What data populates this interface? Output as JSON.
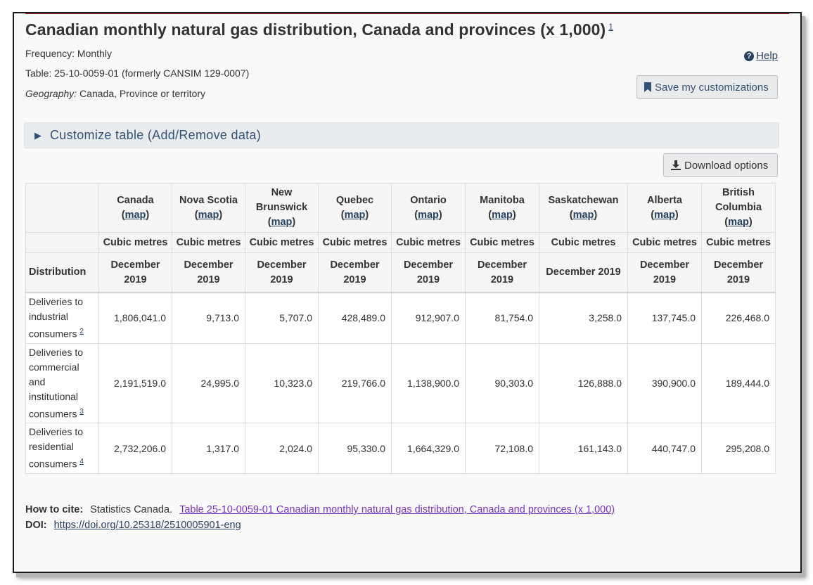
{
  "title": "Canadian monthly natural gas distribution, Canada and provinces (x 1,000)",
  "title_footnote": "1",
  "frequency": "Frequency: Monthly",
  "table_id": "Table: 25-10-0059-01 (formerly CANSIM 129-0007)",
  "geography_label": "Geography:",
  "geography_value": "Canada, Province or territory",
  "help_label": "Help",
  "save_label": "Save my customizations",
  "customize_label": "Customize table (Add/Remove data)",
  "download_label": "Download options",
  "table": {
    "map_link": "map",
    "row_header_label": "Distribution",
    "columns": [
      {
        "name": "Canada",
        "unit": "Cubic metres",
        "period": "December 2019"
      },
      {
        "name": "Nova Scotia",
        "unit": "Cubic metres",
        "period": "December 2019"
      },
      {
        "name": "New Brunswick",
        "unit": "Cubic metres",
        "period": "December 2019"
      },
      {
        "name": "Quebec",
        "unit": "Cubic metres",
        "period": "December 2019"
      },
      {
        "name": "Ontario",
        "unit": "Cubic metres",
        "period": "December 2019"
      },
      {
        "name": "Manitoba",
        "unit": "Cubic metres",
        "period": "December 2019"
      },
      {
        "name": "Saskatchewan",
        "unit": "Cubic metres",
        "period": "December 2019"
      },
      {
        "name": "Alberta",
        "unit": "Cubic metres",
        "period": "December 2019"
      },
      {
        "name": "British Columbia",
        "unit": "Cubic metres",
        "period": "December 2019"
      }
    ],
    "rows": [
      {
        "label": "Deliveries to industrial consumers",
        "footnote": "2",
        "values": [
          "1,806,041.0",
          "9,713.0",
          "5,707.0",
          "428,489.0",
          "912,907.0",
          "81,754.0",
          "3,258.0",
          "137,745.0",
          "226,468.0"
        ]
      },
      {
        "label": "Deliveries to commercial and institutional consumers",
        "footnote": "3",
        "values": [
          "2,191,519.0",
          "24,995.0",
          "10,323.0",
          "219,766.0",
          "1,138,900.0",
          "90,303.0",
          "126,888.0",
          "390,900.0",
          "189,444.0"
        ]
      },
      {
        "label": "Deliveries to residential consumers",
        "footnote": "4",
        "values": [
          "2,732,206.0",
          "1,317.0",
          "2,024.0",
          "95,330.0",
          "1,664,329.0",
          "72,108.0",
          "161,143.0",
          "440,747.0",
          "295,208.0"
        ]
      }
    ]
  },
  "cite": {
    "how_label": "How to cite:",
    "source": "Statistics Canada.",
    "link_text": "Table  25-10-0059-01   Canadian monthly natural gas distribution, Canada and provinces (x 1,000)",
    "doi_label": "DOI:",
    "doi_url": "https://doi.org/10.25318/2510005901-eng"
  }
}
